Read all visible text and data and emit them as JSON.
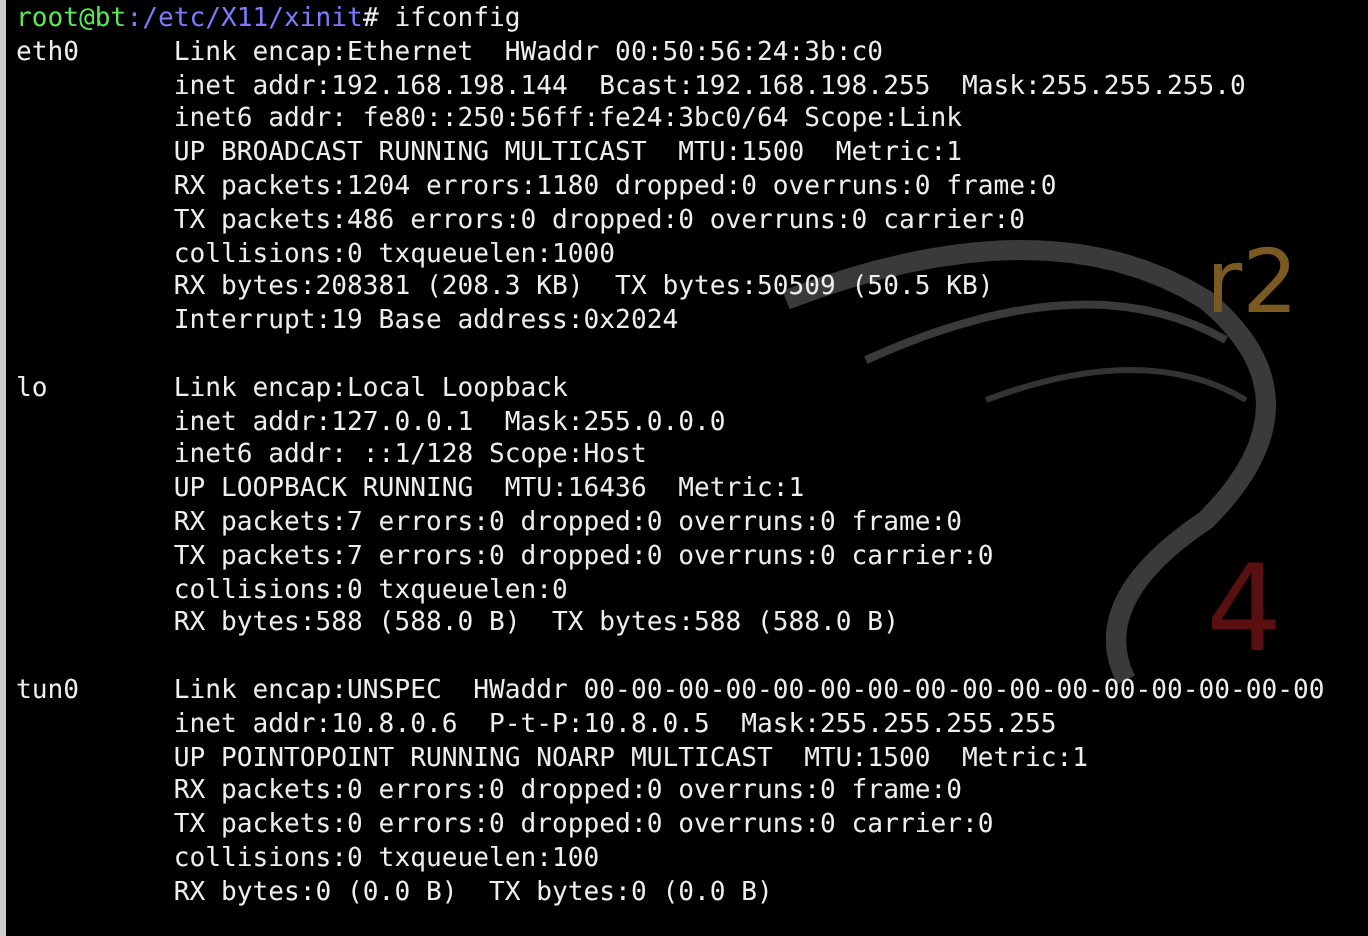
{
  "prompt": {
    "user_host": "root@bt",
    "path": ":/etc/X11/xinit",
    "symbol": "#",
    "command": "ifconfig"
  },
  "interfaces": [
    {
      "name": "eth0",
      "lines": [
        "Link encap:Ethernet  HWaddr 00:50:56:24:3b:c0",
        "inet addr:192.168.198.144  Bcast:192.168.198.255  Mask:255.255.255.0",
        "inet6 addr: fe80::250:56ff:fe24:3bc0/64 Scope:Link",
        "UP BROADCAST RUNNING MULTICAST  MTU:1500  Metric:1",
        "RX packets:1204 errors:1180 dropped:0 overruns:0 frame:0",
        "TX packets:486 errors:0 dropped:0 overruns:0 carrier:0",
        "collisions:0 txqueuelen:1000",
        "RX bytes:208381 (208.3 KB)  TX bytes:50509 (50.5 KB)",
        "Interrupt:19 Base address:0x2024"
      ]
    },
    {
      "name": "lo",
      "lines": [
        "Link encap:Local Loopback",
        "inet addr:127.0.0.1  Mask:255.0.0.0",
        "inet6 addr: ::1/128 Scope:Host",
        "UP LOOPBACK RUNNING  MTU:16436  Metric:1",
        "RX packets:7 errors:0 dropped:0 overruns:0 frame:0",
        "TX packets:7 errors:0 dropped:0 overruns:0 carrier:0",
        "collisions:0 txqueuelen:0",
        "RX bytes:588 (588.0 B)  TX bytes:588 (588.0 B)"
      ]
    },
    {
      "name": "tun0",
      "lines": [
        "Link encap:UNSPEC  HWaddr 00-00-00-00-00-00-00-00-00-00-00-00-00-00-00-00",
        "inet addr:10.8.0.6  P-t-P:10.8.0.5  Mask:255.255.255.255",
        "UP POINTOPOINT RUNNING NOARP MULTICAST  MTU:1500  Metric:1",
        "RX packets:0 errors:0 dropped:0 overruns:0 frame:0",
        "TX packets:0 errors:0 dropped:0 overruns:0 carrier:0",
        "collisions:0 txqueuelen:100",
        "RX bytes:0 (0.0 B)  TX bytes:0 (0.0 B)"
      ]
    }
  ],
  "wallpaper": {
    "version": "4",
    "badge": "r2"
  }
}
